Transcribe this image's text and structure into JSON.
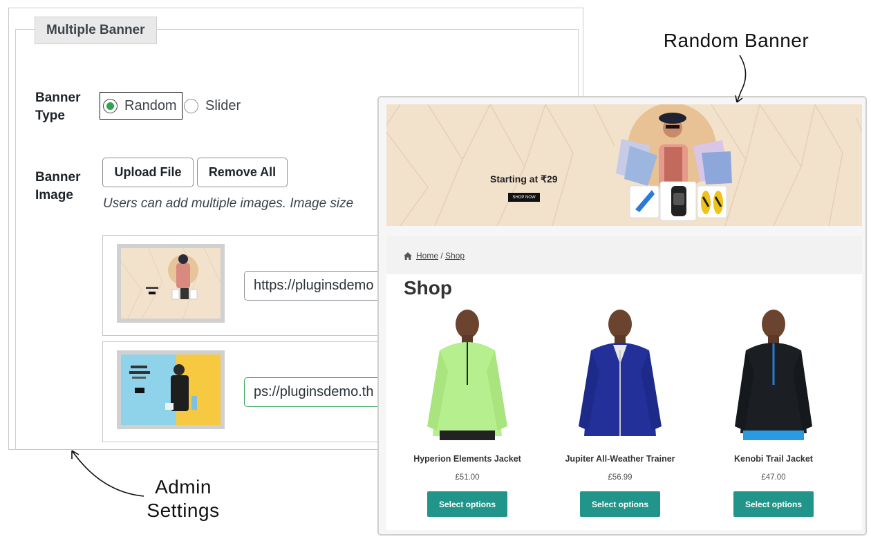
{
  "admin": {
    "section_title": "Multiple Banner",
    "banner_type_label_1": "Banner",
    "banner_type_label_2": "Type",
    "banner_type_options": [
      "Random",
      "Slider"
    ],
    "banner_type_selected": "Random",
    "banner_image_label_1": "Banner",
    "banner_image_label_2": "Image",
    "upload_button": "Upload File",
    "remove_button": "Remove All",
    "help_text": "Users can add multiple images. Image size",
    "images": [
      {
        "url": "https://pluginsdemo"
      },
      {
        "url": "ps://pluginsdemo.th"
      }
    ]
  },
  "shop": {
    "hero_text": "Starting at ₹29",
    "hero_button": "SHOP NOW",
    "breadcrumb": {
      "home": "Home",
      "sep": "/",
      "current": "Shop"
    },
    "title": "Shop",
    "products": [
      {
        "name": "Hyperion Elements Jacket",
        "price": "£51.00",
        "button": "Select options",
        "color": "#b6ef8e"
      },
      {
        "name": "Jupiter All-Weather Trainer",
        "price": "£56.99",
        "button": "Select options",
        "color": "#23309a"
      },
      {
        "name": "Kenobi Trail Jacket",
        "price": "£47.00",
        "button": "Select options",
        "color": "#1b1e22"
      }
    ],
    "accent_color": "#22958a"
  },
  "annotations": {
    "random_banner": "Random Banner",
    "admin_settings_1": "Admin",
    "admin_settings_2": "Settings"
  }
}
